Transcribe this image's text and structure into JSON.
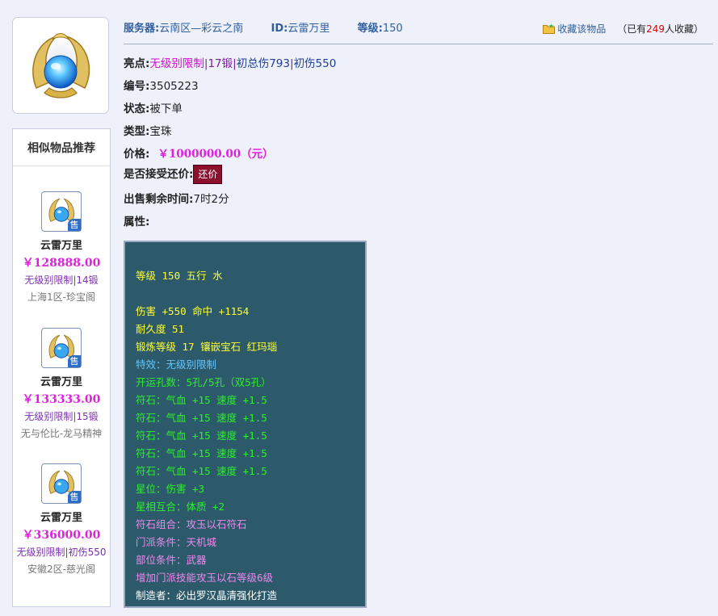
{
  "header": {
    "server_label": "服务器:",
    "server_value": "云南区—彩云之南",
    "id_label": "ID:",
    "id_value": "云雷万里",
    "level_label": "等级:",
    "level_value": "150",
    "fav_link": "收藏该物品",
    "fav_prefix": "（已有",
    "fav_count": "249",
    "fav_suffix": "人收藏）"
  },
  "info": {
    "highlight_label": "亮点:",
    "highlights": [
      "无级别限制",
      "17锻",
      "初总伤793",
      "初伤550"
    ],
    "number_label": "编号:",
    "number_value": "3505223",
    "status_label": "状态:",
    "status_value": "被下单",
    "type_label": "类型:",
    "type_value": "宝珠",
    "price_label": "价格:",
    "price_value": "￥1000000.00（元）",
    "bargain_label": "是否接受还价:",
    "bargain_button": "还价",
    "remaining_label": "出售剩余时间:",
    "remaining_value": "7时2分",
    "attr_label": "属性:"
  },
  "attributes": [
    {
      "text": "等级 150 五行 水",
      "color": "#ffff33"
    },
    {
      "text": "伤害 +550 命中 +1154",
      "color": "#ffff33"
    },
    {
      "text": "耐久度 51",
      "color": "#ffff33"
    },
    {
      "text": "锻炼等级 17 镶嵌宝石 红玛瑙",
      "color": "#ffff33"
    },
    {
      "text": "特效：无级别限制",
      "color": "#62c6ff"
    },
    {
      "text": "开运孔数：5孔/5孔（双5孔）",
      "color": "#2cf02c"
    },
    {
      "text": "符石：气血 +15 速度 +1.5",
      "color": "#2cf02c"
    },
    {
      "text": "符石：气血 +15 速度 +1.5",
      "color": "#2cf02c"
    },
    {
      "text": "符石：气血 +15 速度 +1.5",
      "color": "#2cf02c"
    },
    {
      "text": "符石：气血 +15 速度 +1.5",
      "color": "#2cf02c"
    },
    {
      "text": "符石：气血 +15 速度 +1.5",
      "color": "#2cf02c"
    },
    {
      "text": "星位：伤害 +3",
      "color": "#2cf02c"
    },
    {
      "text": "星相互合：体质 +2",
      "color": "#2cf02c"
    },
    {
      "text": "符石组合：攻玉以石符石",
      "color": "#ee88ee"
    },
    {
      "text": "门派条件：天机城",
      "color": "#ee88ee"
    },
    {
      "text": "部位条件：武器",
      "color": "#ee88ee"
    },
    {
      "text": "增加门派技能攻玉以石等级6级",
      "color": "#ee88ee"
    },
    {
      "text": "制造者：必出罗汉晶清强化打造",
      "color": "#ffffff"
    }
  ],
  "similar": {
    "title": "相似物品推荐",
    "badge": "售",
    "items": [
      {
        "name": "云雷万里",
        "price": "￥128888.00",
        "tag_a": "无级别限制",
        "tag_b": "14锻",
        "server": "上海1区-珍宝阁"
      },
      {
        "name": "云雷万里",
        "price": "￥133333.00",
        "tag_a": "无级别限制",
        "tag_b": "15锻",
        "server": "无与伦比-龙马精神"
      },
      {
        "name": "云雷万里",
        "price": "￥336000.00",
        "tag_a": "无级别限制",
        "tag_b": "初伤550",
        "server": "安徽2区-慈光阁"
      }
    ]
  },
  "icons": {
    "main_image": "jewel-orb-icon",
    "thumbnail": "jewel-orb-icon",
    "favorite": "folder-star-icon"
  }
}
